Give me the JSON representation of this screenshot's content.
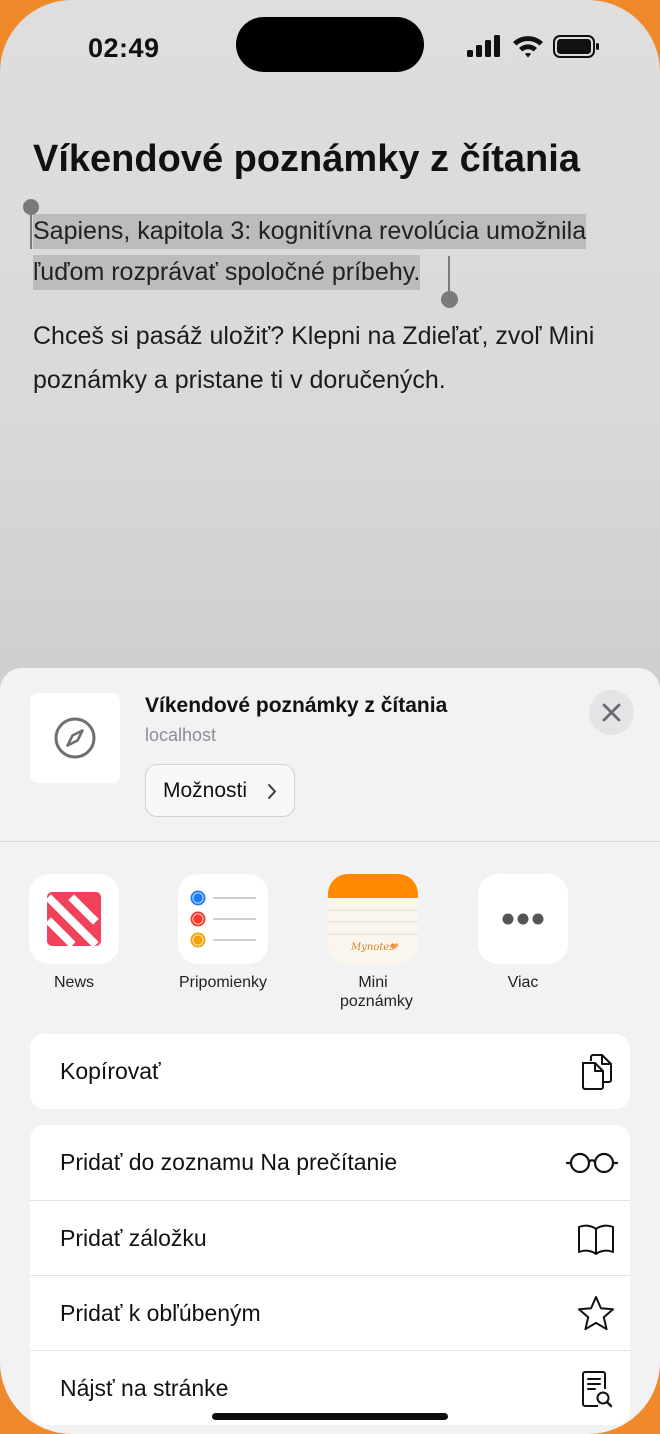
{
  "status_bar": {
    "time": "02:49"
  },
  "page": {
    "title": "Víkendové poznámky z čítania",
    "selected_text": "Sapiens, kapitola 3: kognitívna revolúcia umožnila ľuďom rozprávať spoločné príbehy.",
    "hint_text": "Chceš si pasáž uložiť? Klepni na Zdieľať, zvoľ Mini poznámky a pristane ti v doručených."
  },
  "share_sheet": {
    "preview": {
      "title": "Víkendové poznámky z čítania",
      "subtitle": "localhost",
      "options_label": "Možnosti"
    },
    "apps": [
      {
        "label": "News",
        "icon": "news-icon"
      },
      {
        "label": "Pripomienky",
        "icon": "reminders-icon"
      },
      {
        "label": "Mini poznámky",
        "icon": "mini-notes-icon",
        "icon_text": "Mynotes"
      },
      {
        "label": "Viac",
        "icon": "more-icon"
      }
    ],
    "actions_primary": [
      {
        "label": "Kopírovať",
        "icon": "copy-icon"
      }
    ],
    "actions_secondary": [
      {
        "label": "Pridať do zoznamu Na prečítanie",
        "icon": "glasses-icon"
      },
      {
        "label": "Pridať záložku",
        "icon": "book-icon"
      },
      {
        "label": "Pridať k obľúbeným",
        "icon": "star-icon"
      },
      {
        "label": "Nájsť na stránke",
        "icon": "find-in-page-icon"
      }
    ]
  },
  "colors": {
    "background_accent": "#f0892a",
    "selection_highlight": "#bcbcbc",
    "news_red": "#f2415a",
    "notes_orange": "#ff8a00"
  }
}
